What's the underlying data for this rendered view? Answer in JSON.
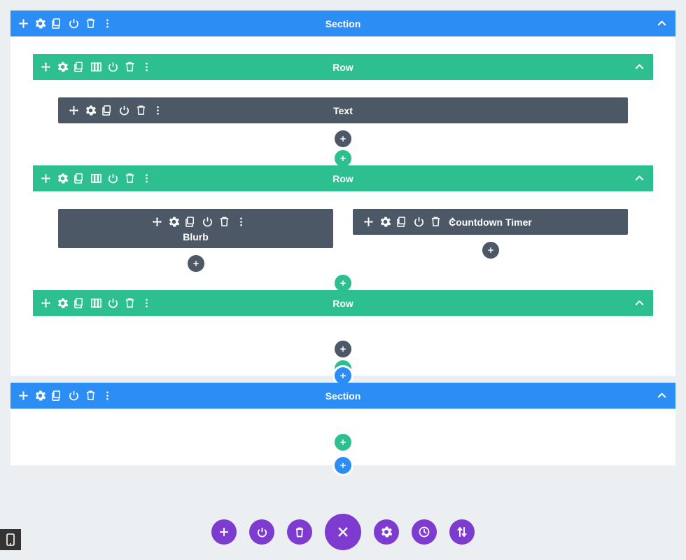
{
  "sections": [
    {
      "label": "Section",
      "rows": [
        {
          "label": "Row",
          "columns": [
            {
              "modules": [
                {
                  "label": "Text",
                  "tall": false
                }
              ]
            }
          ]
        },
        {
          "label": "Row",
          "columns": [
            {
              "modules": [
                {
                  "label": "Blurb",
                  "tall": true
                }
              ]
            },
            {
              "modules": [
                {
                  "label": "Countdown Timer",
                  "tall": false
                }
              ]
            }
          ]
        },
        {
          "label": "Row",
          "columns": [
            {
              "modules": []
            }
          ]
        }
      ]
    },
    {
      "label": "Section",
      "rows": []
    }
  ],
  "icons": {
    "move": "move-icon",
    "gear": "gear-icon",
    "duplicate": "duplicate-icon",
    "columns": "columns-icon",
    "power": "power-icon",
    "trash": "trash-icon",
    "more": "more-icon",
    "chevron": "chevron-up-icon",
    "plus": "plus-icon",
    "close": "close-icon",
    "history": "history-icon",
    "equalizer": "equalizer-icon",
    "mobile": "mobile-icon"
  }
}
